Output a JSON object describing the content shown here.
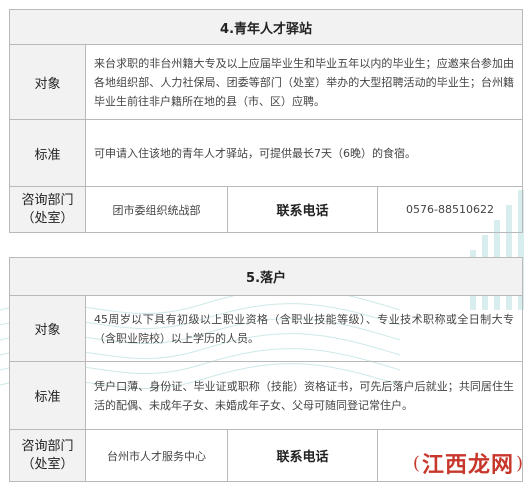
{
  "sections": [
    {
      "title": "4.青年人才驿站",
      "rows": [
        {
          "label": "对象",
          "text": "来台求职的非台州籍大专及以上应届毕业生和毕业五年以内的毕业生；应邀来台参加由各地组织部、人力社保局、团委等部门（处室）举办的大型招聘活动的毕业生；台州籍毕业生前往非户籍所在地的县（市、区）应聘。"
        },
        {
          "label": "标准",
          "text": "可申请入住该地的青年人才驿站，可提供最长7天（6晚）的食宿。"
        }
      ],
      "contact": {
        "label_line1": "咨询部门",
        "label_line2": "（处室）",
        "dept": "团市委组织统战部",
        "phone_label": "联系电话",
        "phone": "0576-88510622"
      }
    },
    {
      "title": "5.落户",
      "rows": [
        {
          "label": "对象",
          "text": "45周岁以下具有初级以上职业资格（含职业技能等级）、专业技术职称或全日制大专（含职业院校）以上学历的人员。"
        },
        {
          "label": "标准",
          "text": "凭户口薄、身份证、毕业证或职称（技能）资格证书，可先后落户后就业；共同居住生活的配偶、未成年子女、未婚成年子女、父母可随同登记常住户。"
        }
      ],
      "contact": {
        "label_line1": "咨询部门",
        "label_line2": "（处室）",
        "dept": "台州市人才服务中心",
        "phone_label": "联系电话",
        "phone": ""
      }
    }
  ],
  "watermark": {
    "paren_open": "(",
    "text": "江西龙网",
    "paren_close": ")"
  },
  "colors": {
    "border": "#b9b9b9",
    "label_bg": "#f2f2f2",
    "accent": "#c8372b",
    "deco": "#bfe3e3"
  }
}
